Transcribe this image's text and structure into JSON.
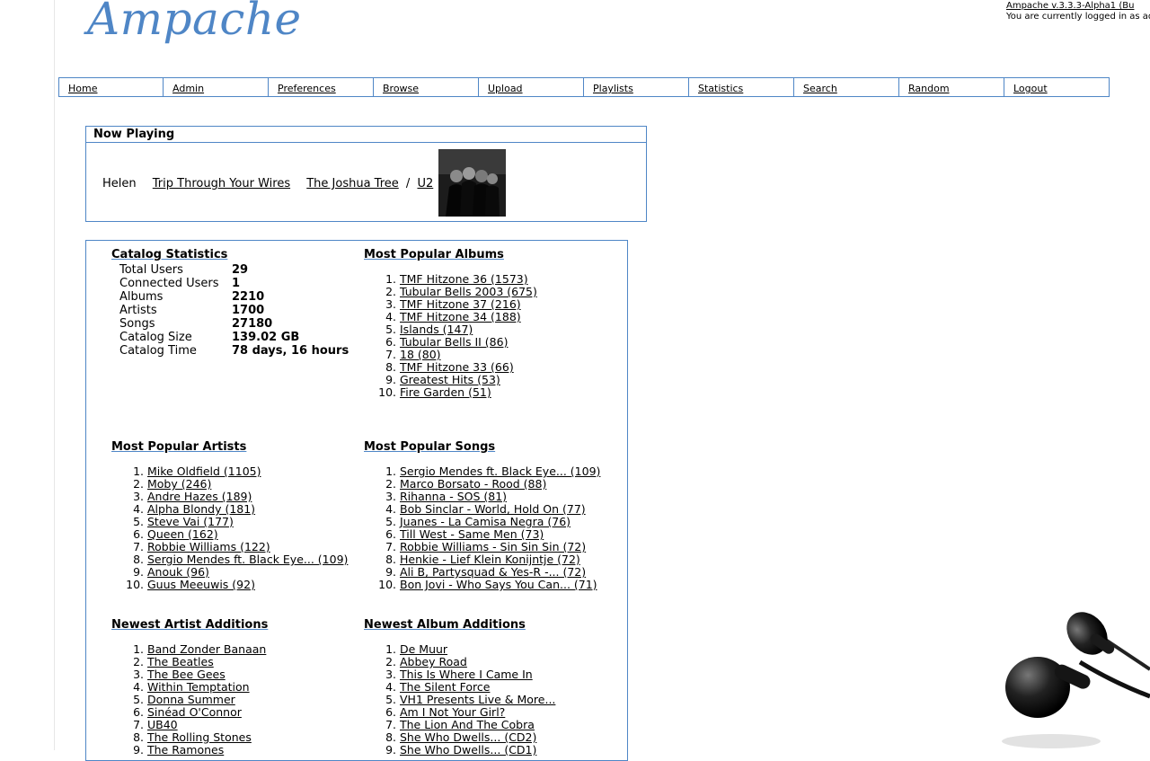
{
  "app": {
    "logo": "Ampache"
  },
  "topinfo": {
    "version_link": "Ampache v.3.3.3-Alpha1 (Bu",
    "logged_in_text": "You are currently logged in as ad"
  },
  "nav": [
    {
      "label": "Home"
    },
    {
      "label": "Admin"
    },
    {
      "label": "Preferences"
    },
    {
      "label": "Browse"
    },
    {
      "label": "Upload"
    },
    {
      "label": "Playlists"
    },
    {
      "label": "Statistics"
    },
    {
      "label": "Search"
    },
    {
      "label": "Random"
    },
    {
      "label": "Logout"
    }
  ],
  "now_playing": {
    "title": "Now Playing",
    "user": "Helen",
    "song": "Trip Through Your Wires",
    "album": "The Joshua Tree",
    "separator": "/",
    "artist": "U2"
  },
  "catalog": {
    "title": "Catalog Statistics",
    "rows": [
      {
        "k": "Total Users",
        "v": "29"
      },
      {
        "k": "Connected Users",
        "v": "1"
      },
      {
        "k": "Albums",
        "v": "2210"
      },
      {
        "k": "Artists",
        "v": "1700"
      },
      {
        "k": "Songs",
        "v": "27180"
      },
      {
        "k": "Catalog Size",
        "v": "139.02 GB"
      },
      {
        "k": "Catalog Time",
        "v": "78 days, 16 hours"
      }
    ]
  },
  "popular_albums": {
    "title": "Most Popular Albums",
    "items": [
      "TMF Hitzone 36 (1573)",
      "Tubular Bells 2003 (675)",
      "TMF Hitzone 37 (216)",
      "TMF Hitzone 34 (188)",
      "Islands (147)",
      "Tubular Bells II (86)",
      "18 (80)",
      "TMF Hitzone 33 (66)",
      "Greatest Hits (53)",
      "Fire Garden (51)"
    ]
  },
  "popular_artists": {
    "title": "Most Popular Artists",
    "items": [
      "Mike Oldfield (1105)",
      "Moby (246)",
      "Andre Hazes (189)",
      "Alpha Blondy (181)",
      "Steve Vai (177)",
      "Queen (162)",
      "Robbie Williams (122)",
      "Sergio Mendes ft. Black Eye... (109)",
      "Anouk (96)",
      "Guus Meeuwis (92)"
    ]
  },
  "popular_songs": {
    "title": "Most Popular Songs",
    "items": [
      "Sergio Mendes ft. Black Eye... (109)",
      "Marco Borsato - Rood (88)",
      "Rihanna - SOS (81)",
      "Bob Sinclar - World, Hold On (77)",
      "Juanes - La Camisa Negra (76)",
      "Till West - Same Men (73)",
      "Robbie Williams - Sin Sin Sin (72)",
      "Henkie - Lief Klein Konijntje (72)",
      "Ali B, Partysquad & Yes-R -... (72)",
      "Bon Jovi - Who Says You Can... (71)"
    ]
  },
  "newest_artists": {
    "title": "Newest Artist Additions",
    "items": [
      "Band Zonder Banaan",
      "The Beatles",
      "The Bee Gees",
      "Within Temptation",
      "Donna Summer",
      "Sinéad O'Connor",
      "UB40",
      "The Rolling Stones",
      "The Ramones"
    ]
  },
  "newest_albums": {
    "title": "Newest Album Additions",
    "items": [
      "De Muur",
      "Abbey Road",
      "This Is Where I Came In",
      "The Silent Force",
      "VH1 Presents Live & More...",
      "Am I Not Your Girl?",
      "The Lion And The Cobra",
      "She Who Dwells... (CD2)",
      "She Who Dwells... (CD1)"
    ]
  },
  "colors": {
    "accent": "#4f86c6"
  },
  "icons": {
    "album_cover": "album-cover-image",
    "decoration": "headphones-image"
  }
}
